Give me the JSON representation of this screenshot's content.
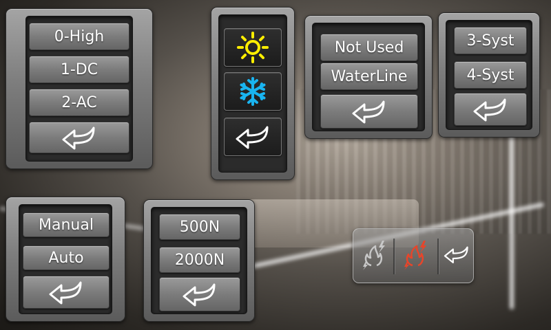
{
  "panel_source": {
    "options": [
      "0-High",
      "1-DC",
      "2-AC"
    ],
    "back_icon": "back-arrow-icon"
  },
  "panel_mode": {
    "options": [
      "sun-icon",
      "snowflake-icon"
    ],
    "back_icon": "back-arrow-icon",
    "colors": {
      "sun": "#ffee00",
      "snow": "#19b4f0"
    }
  },
  "panel_sensor": {
    "options": [
      "Not Used",
      "WaterLine"
    ],
    "back_icon": "back-arrow-icon"
  },
  "panel_system": {
    "options": [
      "3-Syst",
      "4-Syst"
    ],
    "back_icon": "back-arrow-icon"
  },
  "panel_control": {
    "options": [
      "Manual",
      "Auto"
    ],
    "back_icon": "back-arrow-icon"
  },
  "panel_force": {
    "options": [
      "500N",
      "2000N"
    ],
    "back_icon": "back-arrow-icon"
  },
  "panel_burner": {
    "items": [
      "burner-off-icon",
      "burner-on-icon",
      "back-arrow-icon"
    ],
    "colors": {
      "burner_off": "#c8c8c8",
      "burner_on": "#e8452a"
    }
  }
}
